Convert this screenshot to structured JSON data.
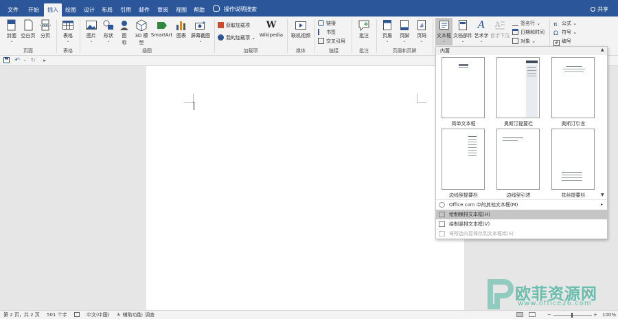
{
  "tabs": [
    "文件",
    "开始",
    "插入",
    "绘图",
    "设计",
    "布局",
    "引用",
    "邮件",
    "审阅",
    "视图",
    "帮助"
  ],
  "active_tab": "插入",
  "tell_me": "操作说明搜索",
  "share": "共享",
  "ribbon": {
    "pages": {
      "cover": "封面",
      "blank": "空白页",
      "break": "分页",
      "group": "页面"
    },
    "tables": {
      "table": "表格",
      "group": "表格"
    },
    "illustrations": {
      "pictures": "图片",
      "shapes": "形状",
      "icons_1": "图",
      "icons_2": "标",
      "model_1": "3D 模",
      "model_2": "型",
      "smartart": "SmartArt",
      "chart": "图表",
      "screenshot": "屏幕截图",
      "group": "插图"
    },
    "addins": {
      "get": "获取加载项",
      "my": "我的加载项",
      "wikipedia": "Wikipedia",
      "group": "加载项"
    },
    "media": {
      "video": "联机视频",
      "group": "媒体"
    },
    "links": {
      "link": "链接",
      "bookmark": "书签",
      "xref": "交叉引用",
      "group": "链接"
    },
    "comments": {
      "comment": "批注",
      "group": "批注"
    },
    "header_footer": {
      "header": "页眉",
      "footer": "页脚",
      "page_number": "页码",
      "group": "页眉和页脚"
    },
    "text": {
      "textbox": "文本框",
      "quickparts": "文档部件",
      "wordart": "艺术字",
      "dropcap": "首字下沉",
      "signature": "签名行",
      "datetime": "日期和时间",
      "object": "对象"
    },
    "symbols": {
      "equation": "公式",
      "symbol": "符号",
      "number": "编号"
    }
  },
  "gallery": {
    "header": "内置",
    "thumbnails": [
      "简单文本框",
      "奥斯汀提要栏",
      "奥斯汀引言",
      "边线型提要栏",
      "边线型引述",
      "花丝提要栏"
    ],
    "menu": [
      {
        "label": "Office.com 中的其他文本框(M)",
        "arrow": "▸"
      },
      {
        "label": "绘制横排文本框(H)"
      },
      {
        "label": "绘制竖排文本框(V)"
      },
      {
        "label": "将所选内容保存到文本框库(S)"
      }
    ]
  },
  "status": {
    "page": "第 2 页，共 2 页",
    "words": "501 个字",
    "language": "中文(中国)",
    "accessibility": "辅助功能: 调查",
    "zoom": "100%"
  },
  "watermark": {
    "cn": "欧菲资源网",
    "url": "www.office26.com"
  },
  "colors": {
    "accent": "#2b579a",
    "ribbon": "#f3f3f3",
    "workspace": "#e6e6e6",
    "watermark": "#4bb5a0"
  }
}
